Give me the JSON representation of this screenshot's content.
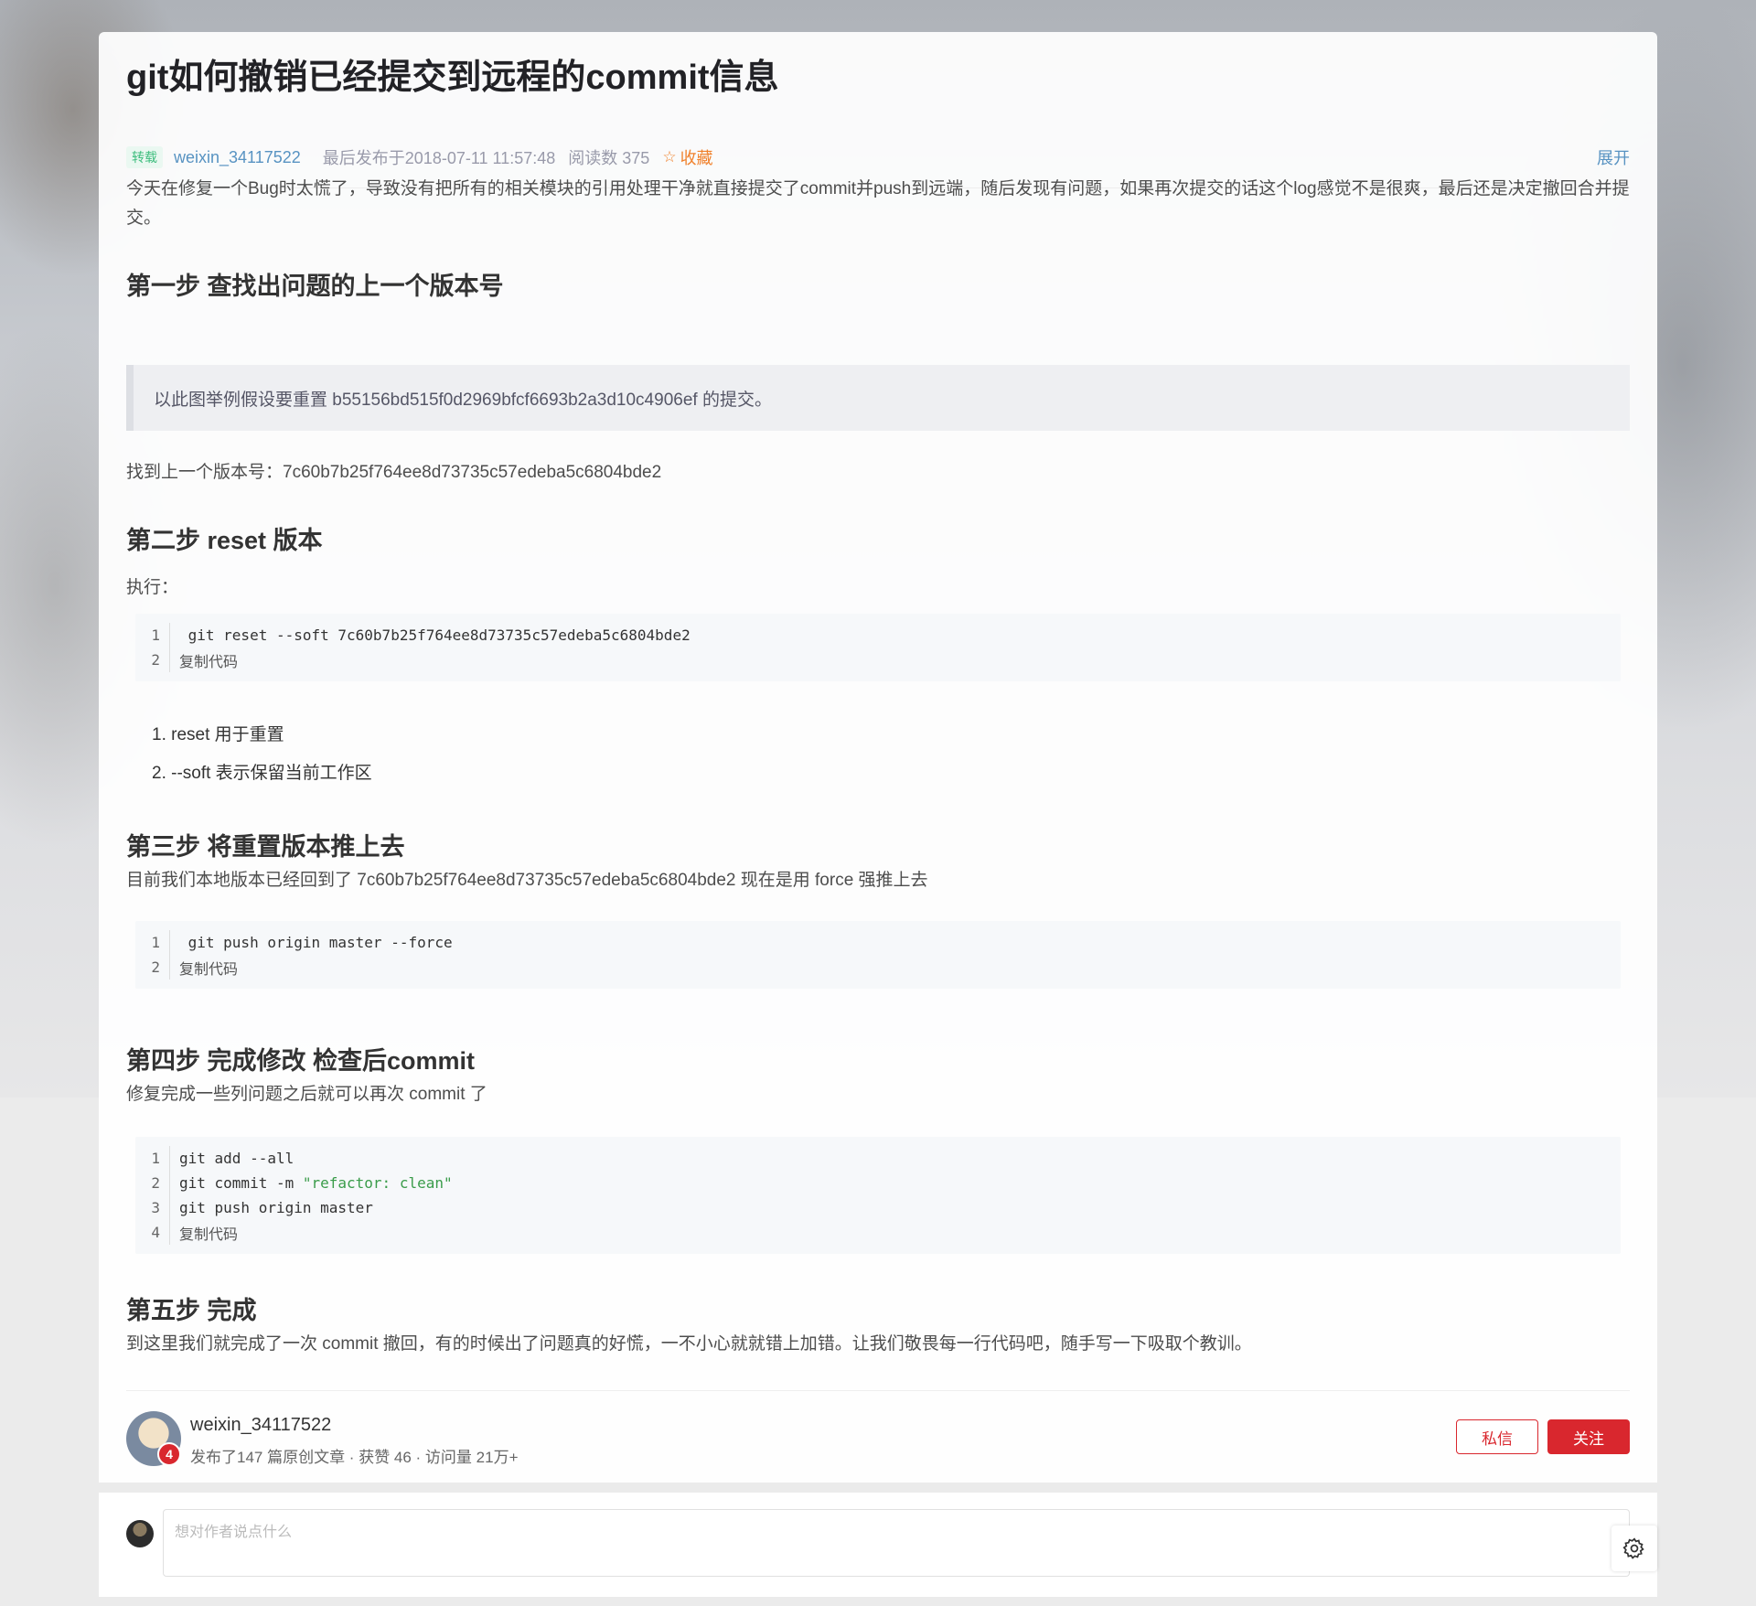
{
  "article": {
    "title": "git如何撤销已经提交到远程的commit信息",
    "tag": "转载",
    "author": "weixin_34117522",
    "date": "最后发布于2018-07-11 11:57:48",
    "reads": "阅读数 375",
    "favorite": "收藏",
    "expand": "展开",
    "intro": "今天在修复一个Bug时太慌了，导致没有把所有的相关模块的引用处理干净就直接提交了commit并push到远端，随后发现有问题，如果再次提交的话这个log感觉不是很爽，最后还是决定撤回合并提交。",
    "step1_heading": "第一步 查找出问题的上一个版本号",
    "quote": "以此图举例假设要重置 b55156bd515f0d2969bfcf6693b2a3d10c4906ef 的提交。",
    "prev_version": "找到上一个版本号：7c60b7b25f764ee8d73735c57edeba5c6804bde2",
    "step2_heading": "第二步 reset 版本",
    "execute": "执行：",
    "code1": [
      {
        "ln": "1",
        "text": " git reset --soft 7c60b7b25f764ee8d73735c57edeba5c6804bde2"
      },
      {
        "ln": "2",
        "text": "复制代码"
      }
    ],
    "list": [
      "1. reset 用于重置",
      "2. --soft 表示保留当前工作区"
    ],
    "step3_heading": "第三步 将重置版本推上去",
    "step3_text": "目前我们本地版本已经回到了 7c60b7b25f764ee8d73735c57edeba5c6804bde2 现在是用 force 强推上去",
    "code2": [
      {
        "ln": "1",
        "text": " git push origin master --force"
      },
      {
        "ln": "2",
        "text": "复制代码"
      }
    ],
    "step4_heading": "第四步 完成修改 检查后commit",
    "step4_text": "修复完成一些列问题之后就可以再次 commit 了",
    "code3": [
      {
        "ln": "1",
        "text": "git add --all"
      },
      {
        "ln": "2",
        "pre": "git commit -m ",
        "str": "\"refactor: clean\""
      },
      {
        "ln": "3",
        "text": "git push origin master"
      },
      {
        "ln": "4",
        "text": "复制代码"
      }
    ],
    "step5_heading": "第五步 完成",
    "step5_text": "到这里我们就完成了一次 commit 撤回，有的时候出了问题真的好慌，一不小心就就错上加错。让我们敬畏每一行代码吧，随手写一下吸取个教训。"
  },
  "author_bar": {
    "name": "weixin_34117522",
    "stats": "发布了147 篇原创文章 · 获赞 46 · 访问量 21万+",
    "badge": "4",
    "message_btn": "私信",
    "follow_btn": "关注"
  },
  "comment": {
    "placeholder": "想对作者说点什么"
  },
  "colors": {
    "accent_red": "#d9272e",
    "link_blue": "#5893c2",
    "favorite_orange": "#f0812c"
  }
}
